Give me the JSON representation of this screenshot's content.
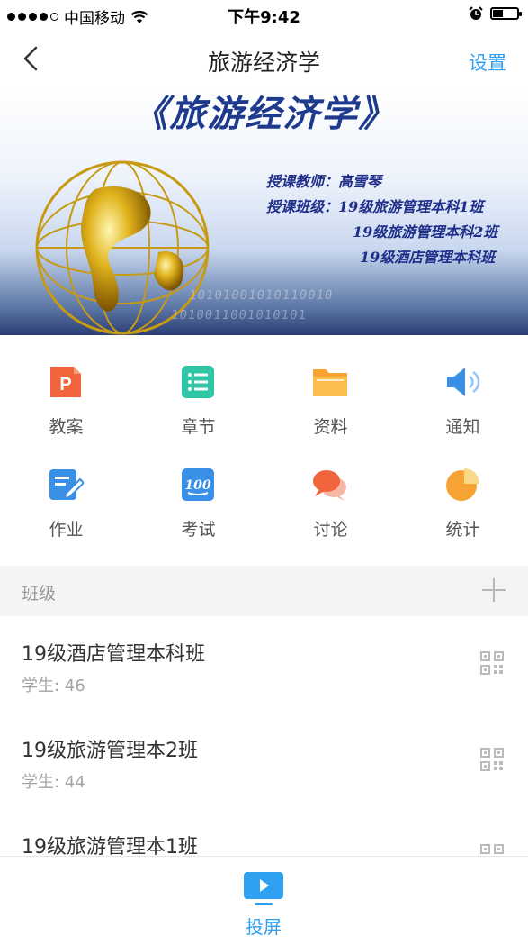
{
  "status_bar": {
    "carrier": "中国移动",
    "time": "下午9:42"
  },
  "nav": {
    "title": "旅游经济学",
    "settings_label": "设置"
  },
  "banner": {
    "title": "《旅游经济学》",
    "teacher_line": "授课教师：高雪琴",
    "class_line_1": "授课班级：19级旅游管理本科1班",
    "class_line_2": "19级旅游管理本科2班",
    "class_line_3": "19级酒店管理本科班",
    "digits_1": "10101001010110010",
    "digits_2": "1010011001010101"
  },
  "menu": {
    "items": [
      {
        "label": "教案",
        "icon": "ppt-file-icon",
        "color": "#f2653c"
      },
      {
        "label": "章节",
        "icon": "list-icon",
        "color": "#2fc6a6"
      },
      {
        "label": "资料",
        "icon": "folder-icon",
        "color": "#f7a334"
      },
      {
        "label": "通知",
        "icon": "speaker-icon",
        "color": "#3a8fe6"
      },
      {
        "label": "作业",
        "icon": "edit-icon",
        "color": "#3a8fe6"
      },
      {
        "label": "考试",
        "icon": "score-100-icon",
        "color": "#3a8fe6"
      },
      {
        "label": "讨论",
        "icon": "chat-bubble-icon",
        "color": "#f2653c"
      },
      {
        "label": "统计",
        "icon": "pie-chart-icon",
        "color": "#f7a334"
      }
    ]
  },
  "classes": {
    "header": "班级",
    "items": [
      {
        "name": "19级酒店管理本科班",
        "students": "学生: 46"
      },
      {
        "name": "19级旅游管理本2班",
        "students": "学生: 44"
      },
      {
        "name": "19级旅游管理本1班",
        "students": ""
      }
    ]
  },
  "bottom": {
    "project_label": "投屏"
  },
  "colors": {
    "accent": "#2f9ff0",
    "section_bg": "#f3f4f6"
  }
}
